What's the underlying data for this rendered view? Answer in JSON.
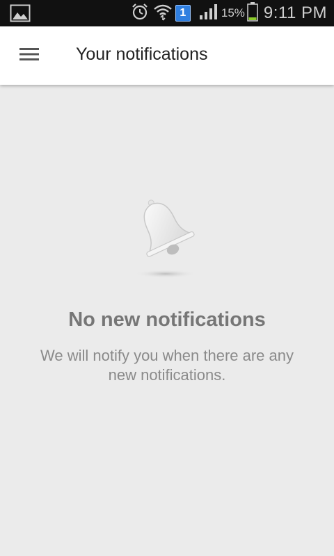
{
  "status_bar": {
    "notification_badge": "1",
    "battery_percent": "15%",
    "time": "9:11 PM",
    "icons": [
      "gallery-icon",
      "alarm-icon",
      "wifi-icon",
      "signal-icon",
      "battery-icon"
    ],
    "battery_color": "#8ccc2a"
  },
  "app_bar": {
    "title": "Your notifications",
    "menu_icon": "hamburger-menu-icon"
  },
  "empty_state": {
    "icon": "bell-icon",
    "title": "No new notifications",
    "message": "We will notify you when there are any new notifications."
  },
  "colors": {
    "background": "#ebebeb",
    "app_bar": "#ffffff",
    "status_bar": "#111111"
  }
}
